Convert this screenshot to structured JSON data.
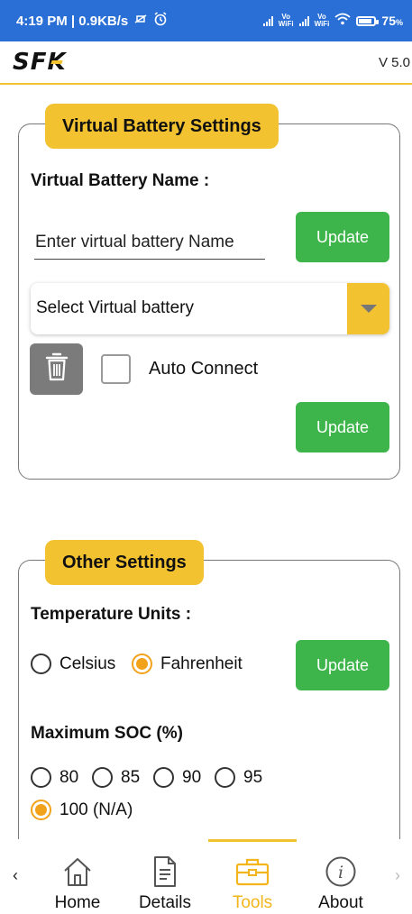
{
  "status_bar": {
    "time_net": "4:19 PM | 0.9KB/s",
    "volte_label_1": "Vo\nWiFi",
    "volte_label_2": "Vo\nWiFi",
    "battery_percent": "75",
    "battery_level": 0.75,
    "battery_suffix": "%",
    "background_color": "#2a6fd6"
  },
  "app_header": {
    "logo_text_1": "SF",
    "logo_text_2": "K",
    "version": "V 5.0",
    "accent_color": "#f2c230"
  },
  "virtual_battery_card": {
    "title": "Virtual Battery Settings",
    "name_label": "Virtual Battery Name :",
    "name_input_placeholder": "Enter virtual battery Name",
    "update_name_button": "Update",
    "select_placeholder": "Select Virtual battery",
    "delete_icon": "trash-icon",
    "auto_connect_label": "Auto Connect",
    "auto_connect_checked": false,
    "update_button": "Update"
  },
  "other_settings_card": {
    "title": "Other Settings",
    "temperature_label": "Temperature Units :",
    "temperature_options": [
      {
        "label": "Celsius",
        "selected": false
      },
      {
        "label": "Fahrenheit",
        "selected": true
      }
    ],
    "temperature_update_button": "Update",
    "max_soc_label": "Maximum SOC (%)",
    "max_soc_options": [
      {
        "label": "80",
        "selected": false
      },
      {
        "label": "85",
        "selected": false
      },
      {
        "label": "90",
        "selected": false
      },
      {
        "label": "95",
        "selected": false
      },
      {
        "label": "100 (N/A)",
        "selected": true
      }
    ]
  },
  "bottom_nav": {
    "left_chevron": "‹",
    "right_chevron": "›",
    "items": [
      {
        "label": "Home",
        "icon": "home-icon",
        "active": false
      },
      {
        "label": "Details",
        "icon": "document-icon",
        "active": false
      },
      {
        "label": "Tools",
        "icon": "toolbox-icon",
        "active": true
      },
      {
        "label": "About",
        "icon": "info-icon",
        "active": false
      }
    ],
    "active_color": "#f2b51c"
  },
  "colors": {
    "green_button": "#3db54a",
    "yellow_accent": "#f2c230",
    "radio_selected": "#f2a21a"
  }
}
